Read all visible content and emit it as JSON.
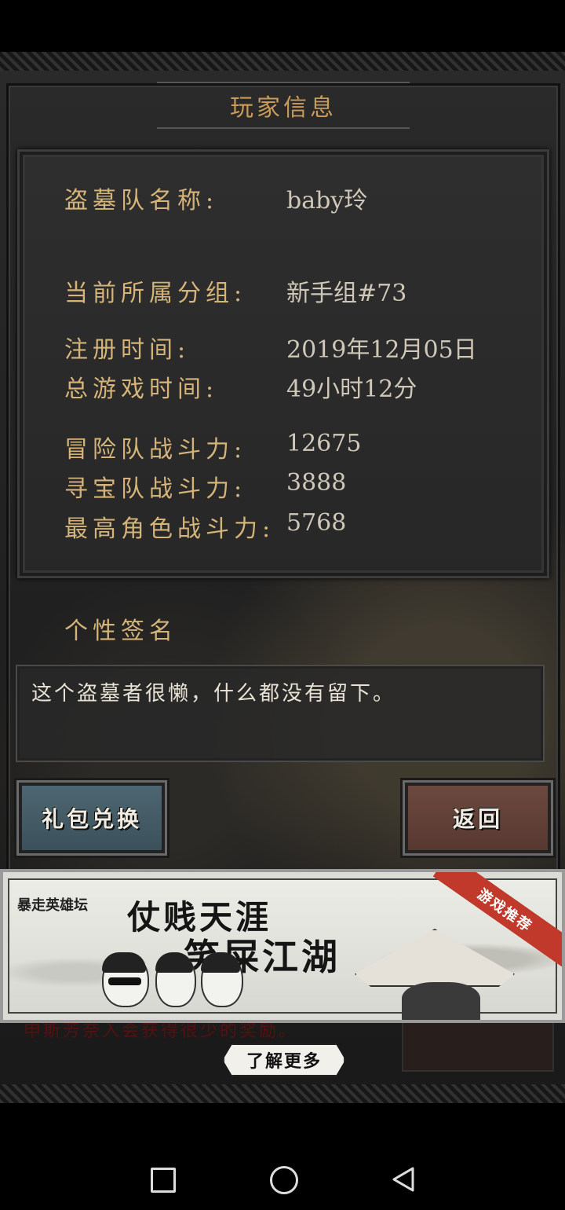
{
  "panel": {
    "title": "玩家信息"
  },
  "player_info": [
    {
      "label": "盗墓队名称:",
      "value": "baby玲"
    },
    {
      "label": "当前所属分组:",
      "value": "新手组#73"
    },
    {
      "label": "注册时间:",
      "value": "2019年12月05日"
    },
    {
      "label": "总游戏时间:",
      "value": "49小时12分"
    },
    {
      "label": "冒险队战斗力:",
      "value": "12675"
    },
    {
      "label": "寻宝队战斗力:",
      "value": "3888"
    },
    {
      "label": "最高角色战斗力:",
      "value": "5768"
    }
  ],
  "signature": {
    "title": "个性签名",
    "text": "这个盗墓者很懒，什么都没有留下。"
  },
  "buttons": {
    "gift_redeem": "礼包兑换",
    "back": "返回"
  },
  "ad": {
    "brand": "暴走英雄坛",
    "line1": "仗贱天涯",
    "line2": "笑屎江湖",
    "ribbon": "游戏推荐",
    "behind_text": "申斯芳奈入会获得很少的奖励。",
    "learn_more": "了解更多"
  },
  "colors": {
    "label": "#d5b47a",
    "value": "#cfc7b8",
    "title": "#c99a58",
    "gift_button": "#4f6873",
    "back_button": "#6e4a40",
    "ad_ribbon": "#c0392b"
  },
  "icons": {
    "nav_recent": "square-icon",
    "nav_home": "circle-icon",
    "nav_back": "triangle-back-icon"
  }
}
